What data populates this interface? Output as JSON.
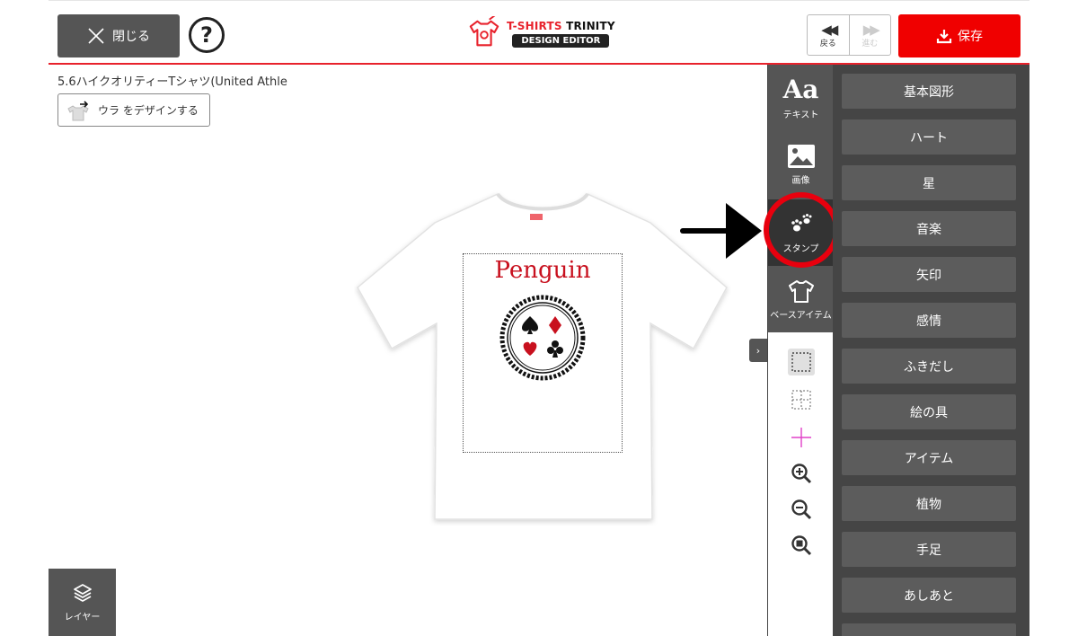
{
  "header": {
    "close_label": "閉じる",
    "help_symbol": "?",
    "logo_line1_red": "T-SHIRTS",
    "logo_line1_black": "TRINITY",
    "logo_line2": "DESIGN EDITOR",
    "undo_label": "戻る",
    "redo_label": "進む",
    "save_label": "保存",
    "accent_color": "#e8222c",
    "save_color": "#f00000"
  },
  "canvas": {
    "product_name": "5.6ハイクオリティーTシャツ(United Athle",
    "back_design_label": "ウラ をデザインする",
    "design_title": "Penguin",
    "layer_label": "レイヤー"
  },
  "tool_tabs": [
    {
      "label": "テキスト",
      "icon": "text-aa-icon",
      "glyph": "Aa"
    },
    {
      "label": "画像",
      "icon": "image-icon"
    },
    {
      "label": "スタンプ",
      "icon": "paw-stamp-icon",
      "active": true
    },
    {
      "label": "ベースアイテム",
      "icon": "tshirt-icon"
    }
  ],
  "canvas_tools": [
    {
      "icon": "select-box-icon",
      "selected": true
    },
    {
      "icon": "grid-guide-icon"
    },
    {
      "icon": "center-cross-icon"
    },
    {
      "icon": "zoom-in-icon"
    },
    {
      "icon": "zoom-out-icon"
    },
    {
      "icon": "zoom-fit-icon"
    }
  ],
  "collapse_glyph": "›",
  "stamp_categories": [
    "基本図形",
    "ハート",
    "星",
    "音楽",
    "矢印",
    "感情",
    "ふきだし",
    "絵の具",
    "アイテム",
    "植物",
    "手足",
    "あしあと"
  ]
}
